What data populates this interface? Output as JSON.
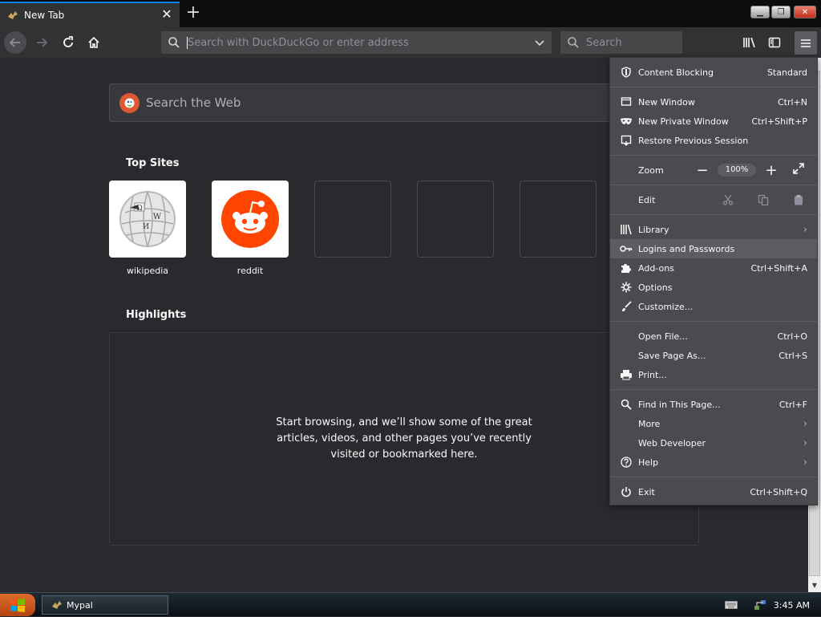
{
  "tab": {
    "title": "New Tab"
  },
  "toolbar": {
    "url_placeholder": "Search with DuckDuckGo or enter address",
    "search_placeholder": "Search"
  },
  "page": {
    "web_search_placeholder": "Search the Web",
    "top_sites_title": "Top Sites",
    "top_sites": [
      {
        "label": "wikipedia"
      },
      {
        "label": "reddit"
      }
    ],
    "highlights_title": "Highlights",
    "highlights_empty": "Start browsing, and we’ll show some of the great articles, videos, and other pages you’ve recently visited or bookmarked here."
  },
  "menu": {
    "content_blocking": {
      "label": "Content Blocking",
      "value": "Standard"
    },
    "new_window": {
      "label": "New Window",
      "shortcut": "Ctrl+N"
    },
    "new_private_window": {
      "label": "New Private Window",
      "shortcut": "Ctrl+Shift+P"
    },
    "restore_session": {
      "label": "Restore Previous Session"
    },
    "zoom": {
      "label": "Zoom",
      "value": "100%"
    },
    "edit": {
      "label": "Edit"
    },
    "library": {
      "label": "Library"
    },
    "logins": {
      "label": "Logins and Passwords"
    },
    "addons": {
      "label": "Add-ons",
      "shortcut": "Ctrl+Shift+A"
    },
    "options": {
      "label": "Options"
    },
    "customize": {
      "label": "Customize..."
    },
    "open_file": {
      "label": "Open File...",
      "shortcut": "Ctrl+O"
    },
    "save_page": {
      "label": "Save Page As...",
      "shortcut": "Ctrl+S"
    },
    "print": {
      "label": "Print..."
    },
    "find": {
      "label": "Find in This Page...",
      "shortcut": "Ctrl+F"
    },
    "more": {
      "label": "More"
    },
    "web_developer": {
      "label": "Web Developer"
    },
    "help": {
      "label": "Help"
    },
    "exit": {
      "label": "Exit",
      "shortcut": "Ctrl+Shift+Q"
    }
  },
  "taskbar": {
    "app_label": "Mypal",
    "clock": "3:45 AM"
  },
  "colors": {
    "accent": "#0a84ff",
    "reddit": "#ff4500",
    "duckduckgo": "#de5833"
  }
}
